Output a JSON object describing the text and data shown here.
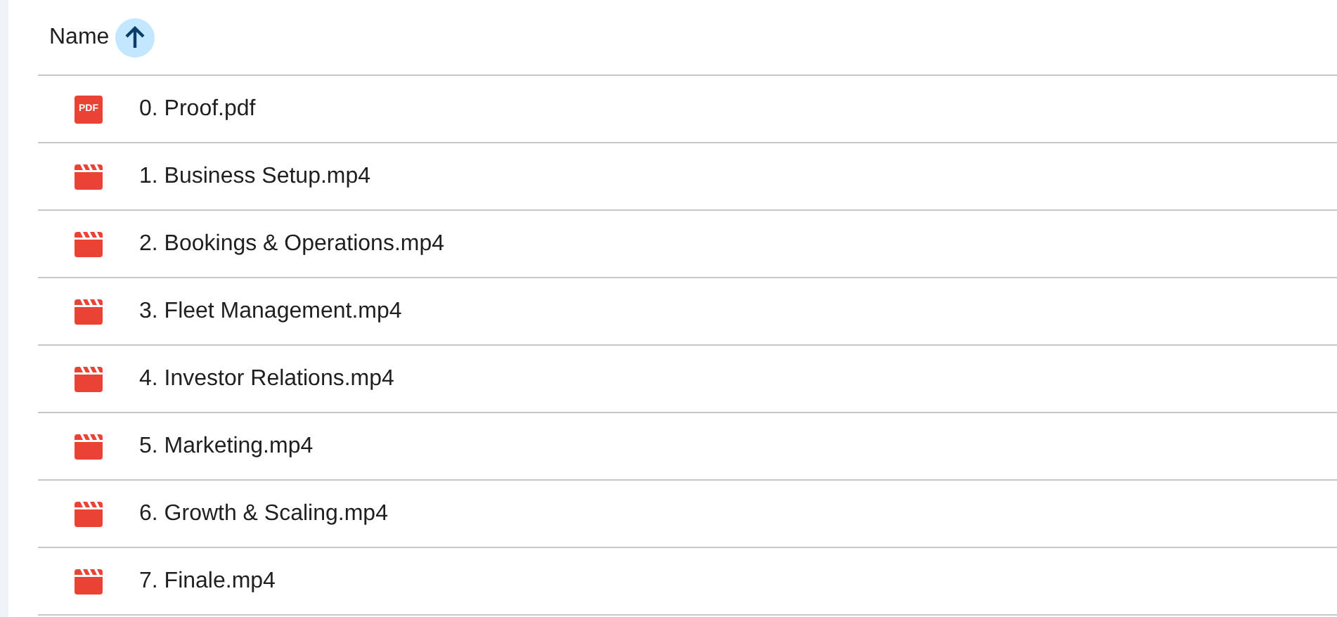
{
  "header": {
    "label": "Name",
    "sort_ascending": true
  },
  "files": [
    {
      "kind": "pdf",
      "icon_label": "PDF",
      "name": "0. Proof.pdf"
    },
    {
      "kind": "video",
      "name": "1. Business Setup.mp4"
    },
    {
      "kind": "video",
      "name": "2. Bookings & Operations.mp4"
    },
    {
      "kind": "video",
      "name": "3. Fleet Management.mp4"
    },
    {
      "kind": "video",
      "name": "4. Investor Relations.mp4"
    },
    {
      "kind": "video",
      "name": "5. Marketing.mp4"
    },
    {
      "kind": "video",
      "name": "6. Growth & Scaling.mp4"
    },
    {
      "kind": "video",
      "name": "7. Finale.mp4"
    }
  ]
}
